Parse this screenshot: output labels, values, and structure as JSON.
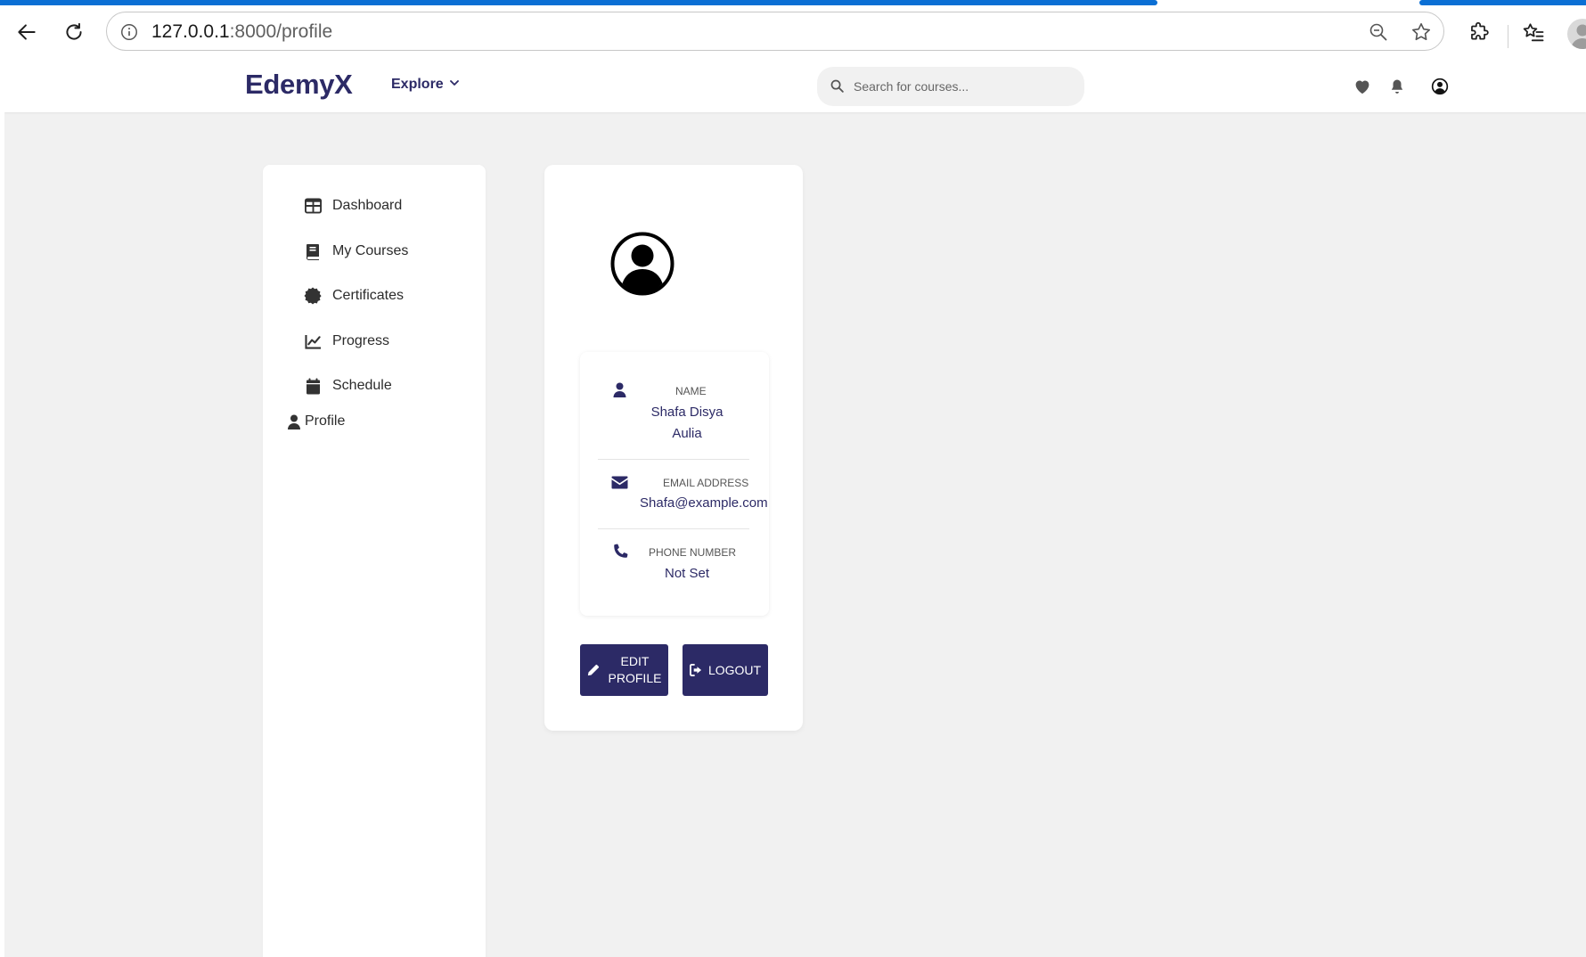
{
  "browser": {
    "url_host": "127.0.0.1",
    "url_path": ":8000/profile",
    "load_progress": 0.73
  },
  "site": {
    "logo": "EdemyX",
    "explore_label": "Explore",
    "search_placeholder": "Search for courses..."
  },
  "sidebar": {
    "items": [
      {
        "label": "Dashboard",
        "icon": "dashboard-grid-icon"
      },
      {
        "label": "My Courses",
        "icon": "book-icon"
      },
      {
        "label": "Certificates",
        "icon": "certificate-badge-icon"
      },
      {
        "label": "Progress",
        "icon": "line-chart-icon"
      },
      {
        "label": "Schedule",
        "icon": "calendar-icon"
      },
      {
        "label": "Profile",
        "icon": "user-icon"
      }
    ]
  },
  "profile": {
    "name_label": "Name",
    "name_line1": "Shafa Disya",
    "name_line2": "Aulia",
    "email_label": "Email Address",
    "email_value": "Shafa@example.com",
    "phone_label": "Phone Number",
    "phone_value": "Not Set"
  },
  "actions": {
    "edit_line1": "Edit",
    "edit_line2": "Profile",
    "logout_label": "Logout"
  },
  "colors": {
    "brand": "#2c2a66",
    "page_bg": "#f1f1f1",
    "progress": "#0b6fd4"
  }
}
